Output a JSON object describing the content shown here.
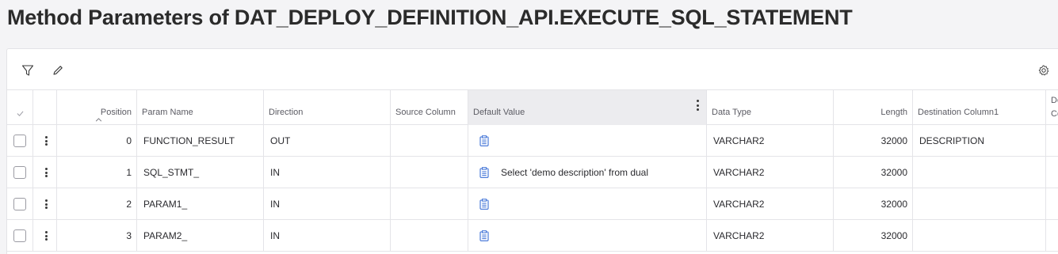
{
  "page": {
    "title": "Method Parameters of DAT_DEPLOY_DEFINITION_API.EXECUTE_SQL_STATEMENT"
  },
  "toolbar": {
    "filter_icon": "filter-icon",
    "edit_icon": "pencil-icon",
    "settings_icon": "gear-icon"
  },
  "columns": {
    "position": "Position",
    "param_name": "Param Name",
    "direction": "Direction",
    "source_column": "Source Column",
    "default_value": "Default Value",
    "data_type": "Data Type",
    "length": "Length",
    "destination_column1": "Destination Column1",
    "next_col_line1": "De",
    "next_col_line2": "Co"
  },
  "rows": [
    {
      "position": "0",
      "param_name": "FUNCTION_RESULT",
      "direction": "OUT",
      "source_column": "",
      "default_value": "",
      "data_type": "VARCHAR2",
      "length": "32000",
      "destination_column1": "DESCRIPTION"
    },
    {
      "position": "1",
      "param_name": "SQL_STMT_",
      "direction": "IN",
      "source_column": "",
      "default_value": "Select 'demo description' from dual",
      "data_type": "VARCHAR2",
      "length": "32000",
      "destination_column1": ""
    },
    {
      "position": "2",
      "param_name": "PARAM1_",
      "direction": "IN",
      "source_column": "",
      "default_value": "",
      "data_type": "VARCHAR2",
      "length": "32000",
      "destination_column1": ""
    },
    {
      "position": "3",
      "param_name": "PARAM2_",
      "direction": "IN",
      "source_column": "",
      "default_value": "",
      "data_type": "VARCHAR2",
      "length": "32000",
      "destination_column1": ""
    }
  ],
  "colors": {
    "accent": "#3b6fd6",
    "border": "#e4e4e8",
    "background": "#f4f4f6",
    "active_header": "#ececef"
  }
}
